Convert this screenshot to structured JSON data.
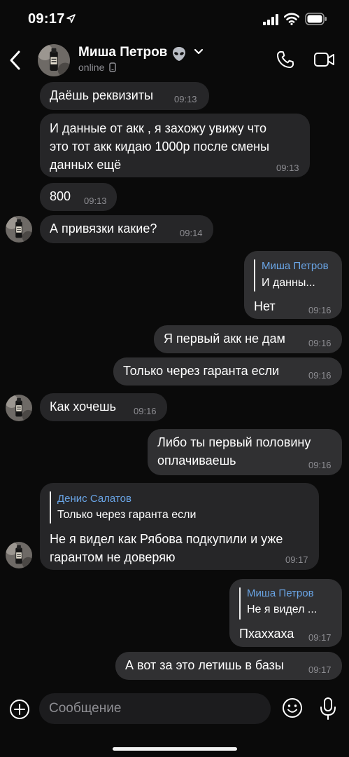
{
  "status_bar": {
    "time": "09:17"
  },
  "header": {
    "name": "Миша Петров",
    "status": "online"
  },
  "messages": [
    {
      "text": "Даёшь реквизиты",
      "time": "09:13"
    },
    {
      "line1": "И данные от акк , я захожу увижу что",
      "line2": "это тот акк кидаю 1000р после смены",
      "line3": "данных ещё",
      "time": "09:13"
    },
    {
      "text": "800",
      "time": "09:13"
    },
    {
      "text": "А привязки какие?",
      "time": "09:14"
    },
    {
      "reply_name": "Миша Петров",
      "reply_text": "И данны...",
      "text": "Нет",
      "time": "09:16"
    },
    {
      "text": "Я первый акк не дам",
      "time": "09:16"
    },
    {
      "text": "Только через гаранта если",
      "time": "09:16"
    },
    {
      "text": "Как хочешь",
      "time": "09:16"
    },
    {
      "line1": "Либо ты первый половину",
      "line2": "оплачиваешь",
      "time": "09:16"
    },
    {
      "reply_name": "Денис Салатов",
      "reply_text": "Только через гаранта если",
      "line1": "Не я видел как Рябова подкупили и уже",
      "line2": "гарантом не доверяю",
      "time": "09:17"
    },
    {
      "reply_name": "Миша Петров",
      "reply_text": "Не я видел ...",
      "text": "Пхаххаха",
      "time": "09:17"
    },
    {
      "text": "А вот за это летишь в базы",
      "time": "09:17"
    }
  ],
  "composer": {
    "placeholder": "Сообщение"
  },
  "icons": {
    "back": "chevron-left-icon",
    "alien": "alien-emoji-icon",
    "chevron_down": "chevron-down-icon",
    "phone": "phone-icon",
    "video": "video-camera-icon",
    "plus": "plus-circle-icon",
    "emoji": "smiley-icon",
    "mic": "microphone-icon",
    "device": "phone-device-icon"
  },
  "colors": {
    "background": "#0a0a0a",
    "incoming_bubble": "#262628",
    "outgoing_bubble": "#303032",
    "reply_name": "#6aa5e6",
    "muted": "#8e8e93"
  }
}
